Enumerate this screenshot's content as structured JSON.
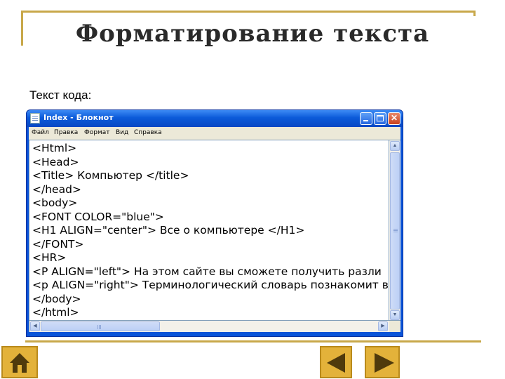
{
  "slide": {
    "title": "Форматирование текста",
    "caption": "Текст кода:"
  },
  "window": {
    "title": "Index - Блокнот",
    "menu": [
      "Файл",
      "Правка",
      "Формат",
      "Вид",
      "Справка"
    ]
  },
  "code_lines": [
    "<Html>",
    "   <Head>",
    "      <Title> Компьютер </title>",
    "   </head>",
    "   <body>",
    "<FONT COLOR=\"blue\">",
    "<H1 ALIGN=\"center\"> Все о компьютере </H1>",
    "</FONT>",
    "<HR>",
    "<P ALIGN=\"left\"> На этом сайте вы сможете получить разли",
    "<p ALIGN=\"right\"> Терминологический словарь познакомит в",
    "   </body>",
    "</html>"
  ],
  "navigation": {
    "home_icon": "home-icon",
    "prev_icon": "arrow-left-icon",
    "next_icon": "arrow-right-icon"
  },
  "colors": {
    "accent_gold": "#c8a84a",
    "button_gold": "#e3b23a",
    "window_blue": "#0a54d8"
  }
}
